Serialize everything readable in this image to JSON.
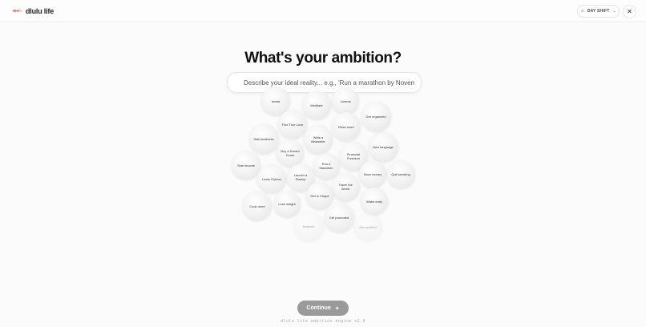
{
  "header": {
    "brand": "dlulu life",
    "shift_label": "DAY SHIFT",
    "shift_icon": "sun-icon",
    "close_icon": "close-icon"
  },
  "main": {
    "title": "What's your ambition?",
    "search_placeholder": "Describe your ideal reality... e.g., 'Run a marathon by November'",
    "search_value": ""
  },
  "bubbles": [
    {
      "label": "Invest"
    },
    {
      "label": "Meditate"
    },
    {
      "label": "Journal"
    },
    {
      "label": "Get organized"
    },
    {
      "label": "Find True Love"
    },
    {
      "label": "Read more"
    },
    {
      "label": "Start business"
    },
    {
      "label": "Write a Bestseller"
    },
    {
      "label": "New language"
    },
    {
      "label": "Buy a Dream Home"
    },
    {
      "label": "Financial Freedom"
    },
    {
      "label": "Side income"
    },
    {
      "label": "Run a Marathon"
    },
    {
      "label": "Save money"
    },
    {
      "label": "Quit smoking"
    },
    {
      "label": "Learn Python"
    },
    {
      "label": "Launch a Startup"
    },
    {
      "label": "Travel the World"
    },
    {
      "label": "Get in Shape"
    },
    {
      "label": "Wake early"
    },
    {
      "label": "Cook more"
    },
    {
      "label": "Lose weight"
    },
    {
      "label": "Get promoted"
    },
    {
      "label": "Network"
    },
    {
      "label": "Get certified"
    }
  ],
  "actions": {
    "continue_label": "Continue"
  },
  "footer": {
    "text": "dlulu life ambition engine v2.0"
  },
  "colors": {
    "brand_accent": "#e05a52",
    "continue_bg": "#9a9a9a",
    "background": "#fbfbfb"
  }
}
